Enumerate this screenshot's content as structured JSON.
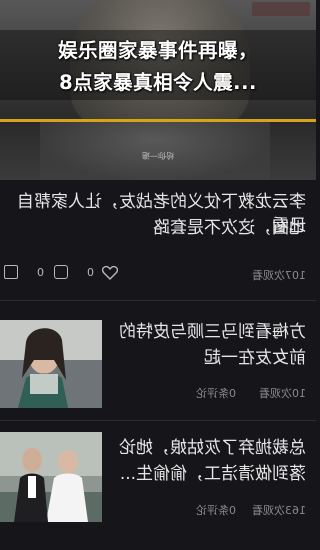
{
  "headline": {
    "line1": "娱乐圈家暴事件再曝，",
    "line2": "8点家暴真相令人震..."
  },
  "video": {
    "subtitle": "给你一遍"
  },
  "article1": {
    "title_line1": "李云龙救下仗义的老战友，让人家帮自己看",
    "title_line2": "地图，这次不是套路",
    "views": "107次观看",
    "comment_count": "0",
    "like_count": "0"
  },
  "article2": {
    "title_line1": "方梅看到马三顺与皮特的",
    "title_line2": "前女友在一起",
    "views": "10次观看",
    "comments": "0条评论"
  },
  "article3": {
    "title_line1": "总裁抛弃了灰姑娘，她论",
    "title_line2": "落到做清洁工，偷偷生...",
    "views": "163次观看",
    "comments": "0条评论"
  },
  "colors": {
    "accent": "#d6a414",
    "background": "#15151a"
  }
}
